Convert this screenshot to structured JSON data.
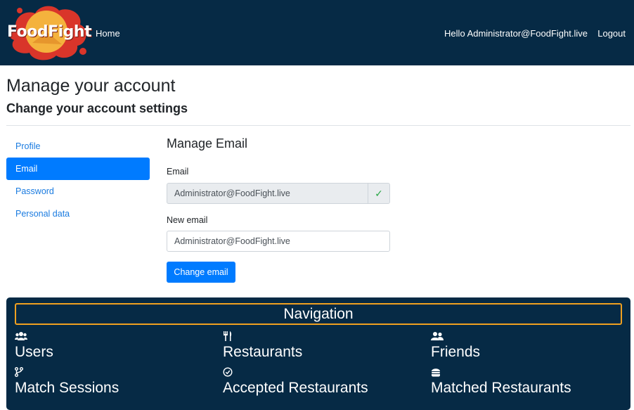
{
  "header": {
    "brand": "FoodFight",
    "home_label": "Home",
    "hello_text": "Hello Administrator@FoodFight.live",
    "logout_label": "Logout"
  },
  "page": {
    "title": "Manage your account",
    "subtitle": "Change your account settings"
  },
  "sidebar": {
    "items": [
      {
        "label": "Profile"
      },
      {
        "label": "Email"
      },
      {
        "label": "Password"
      },
      {
        "label": "Personal data"
      }
    ]
  },
  "form": {
    "section_title": "Manage Email",
    "email_label": "Email",
    "email_value": "Administrator@FoodFight.live",
    "new_email_label": "New email",
    "new_email_value": "Administrator@FoodFight.live",
    "submit_label": "Change email"
  },
  "navigation": {
    "title": "Navigation",
    "items": [
      {
        "label": "Users",
        "icon": "users-icon"
      },
      {
        "label": "Restaurants",
        "icon": "utensils-icon"
      },
      {
        "label": "Friends",
        "icon": "user-friends-icon"
      },
      {
        "label": "Match Sessions",
        "icon": "code-branch-icon"
      },
      {
        "label": "Accepted Restaurants",
        "icon": "check-circle-icon"
      },
      {
        "label": "Matched Restaurants",
        "icon": "burger-icon"
      }
    ]
  },
  "colors": {
    "header_bg": "#062a45",
    "accent": "#007bff",
    "nav_border": "#f0a020",
    "success": "#28a745"
  }
}
